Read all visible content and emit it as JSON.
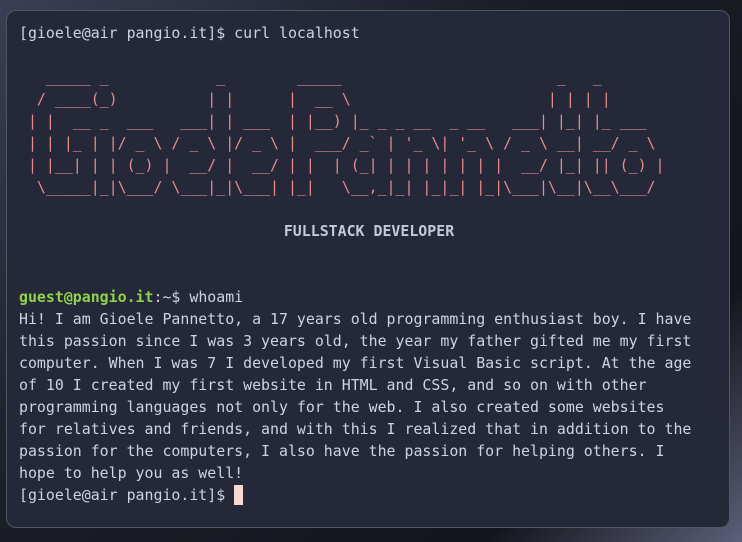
{
  "terminal": {
    "prompt1": "[gioele@air pangio.it]$ ",
    "command1": "curl localhost",
    "ascii_art": "   _____ _            _        _____                        _   _\n  / ____(_)          | |      |  __ \\                      | | | |\n | |  __ _  ___   ___| | ___  | |__) |_ _ _ __  _ __   ___| |_| |_ ___\n | | |_ | |/ _ \\ / _ \\ |/ _ \\ |  ___/ _` | '_ \\| '_ \\ / _ \\ __| __/ _ \\\n | |__| | | (_) |  __/ |  __/ | |  | (_| | | | | | | |  __/ |_| || (_) |\n  \\_____|_|\\___/ \\___|_|\\___| |_|   \\__,_|_| |_|_| |_|\\___|\\__|\\__\\___/",
    "subtitle": "FULLSTACK DEVELOPER",
    "guest_user": "guest@pangio.it",
    "guest_sep": ":~$ ",
    "command2": "whoami",
    "output": "Hi! I am Gioele Pannetto, a 17 years old programming enthusiast boy. I have\nthis passion since I was 3 years old, the year my father gifted me my first\ncomputer. When I was 7 I developed my first Visual Basic script. At the age\nof 10 I created my first website in HTML and CSS, and so on with other\nprogramming languages not only for the web. I also created some websites\nfor relatives and friends, and with this I realized that in addition to the\npassion for the computers, I also have the passion for helping others. I\nhope to help you as well!",
    "prompt2": "[gioele@air pangio.it]$ "
  },
  "colors": {
    "background": "#252839",
    "art": "#e58d8d",
    "prompt_green": "#8fd34a",
    "cursor": "#f6d9d2"
  }
}
